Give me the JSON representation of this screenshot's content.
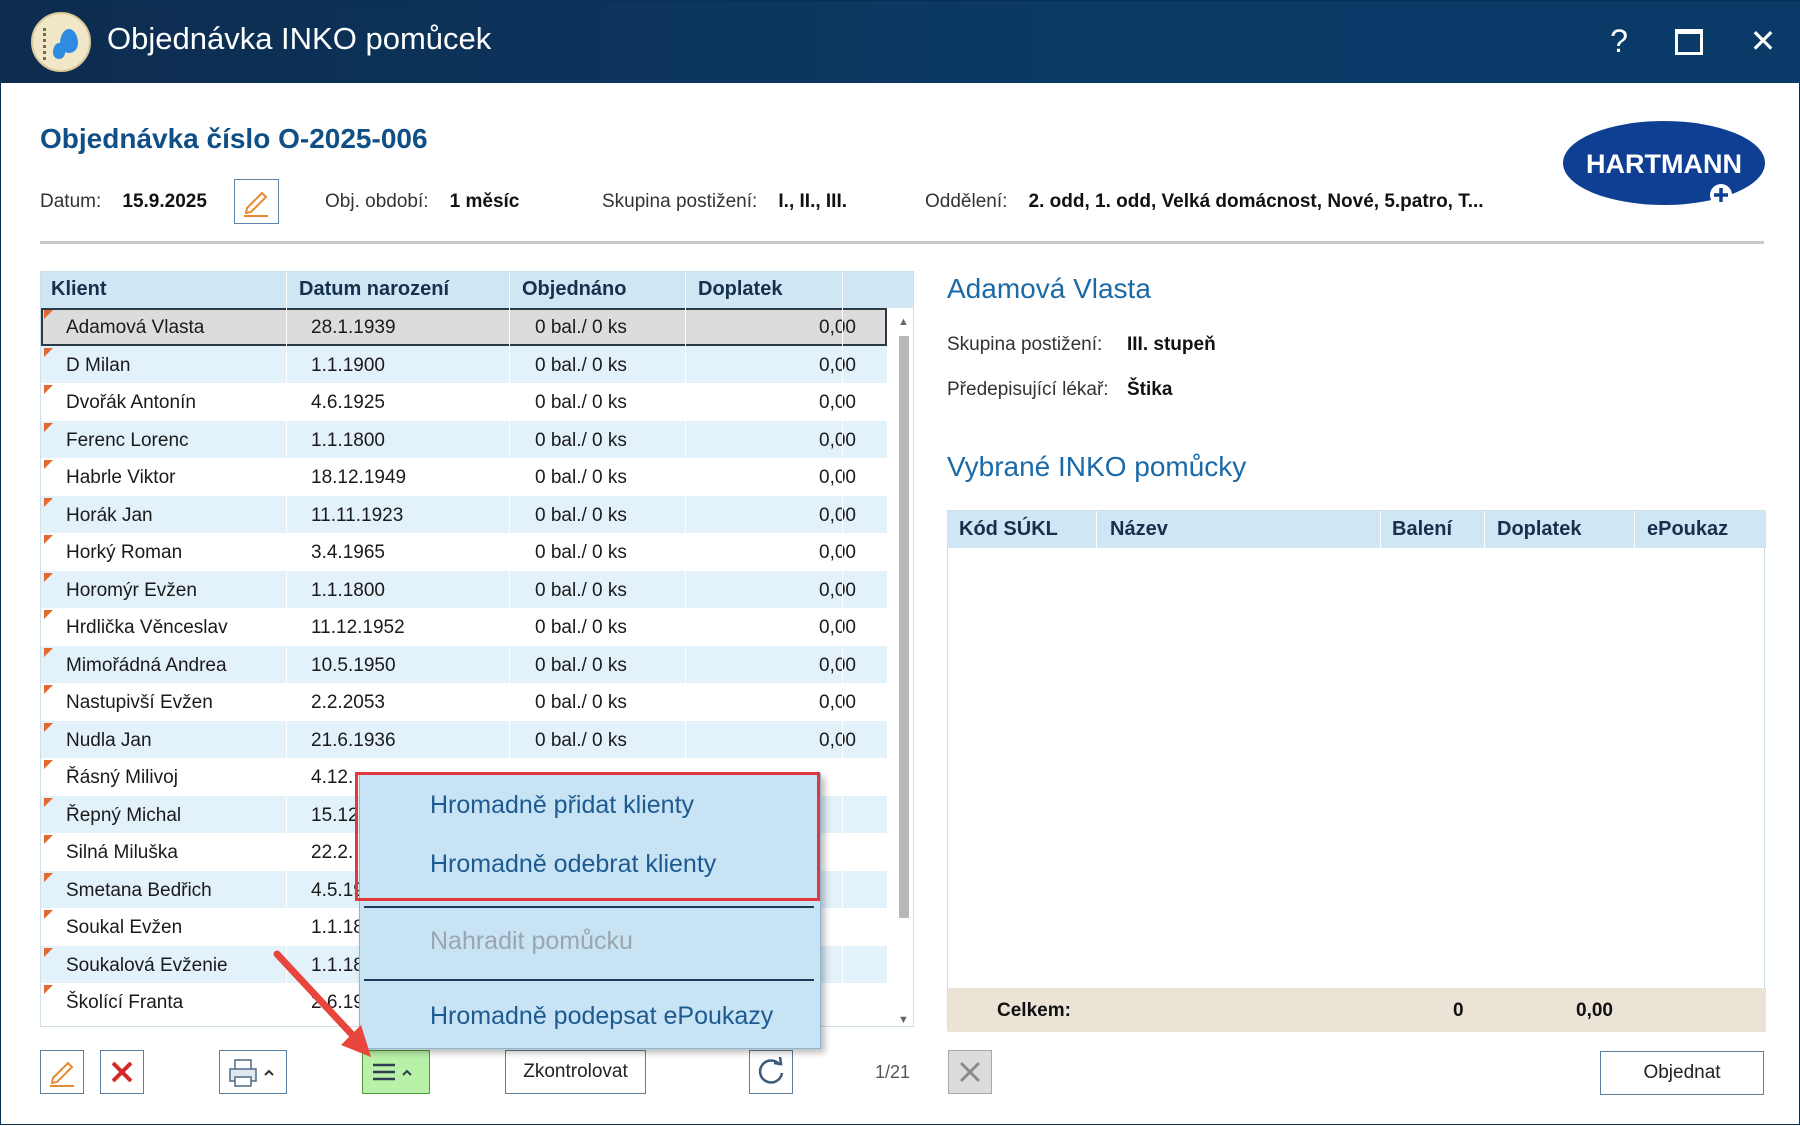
{
  "window": {
    "title": "Objednávka INKO pomůcek",
    "help_label": "?",
    "close_label": "✕"
  },
  "header": {
    "order_title": "Objednávka číslo O-2025-006",
    "brand": "HARTMANN",
    "date_label": "Datum:",
    "date_value": "15.9.2025",
    "period_label": "Obj. období:",
    "period_value": "1 měsíc",
    "group_label": "Skupina postižení:",
    "group_value": "I., II., III.",
    "dept_label": "Oddělení:",
    "dept_value": "2. odd, 1. odd, Velká domácnost, Nové, 5.patro, T..."
  },
  "clients": {
    "columns": [
      "Klient",
      "Datum narození",
      "Objednáno",
      "Doplatek"
    ],
    "rows": [
      [
        "Adamová Vlasta",
        "28.1.1939",
        "0 bal./ 0 ks",
        "0,00"
      ],
      [
        "D Milan",
        "1.1.1900",
        "0 bal./ 0 ks",
        "0,00"
      ],
      [
        "Dvořák Antonín",
        "4.6.1925",
        "0 bal./ 0 ks",
        "0,00"
      ],
      [
        "Ferenc Lorenc",
        "1.1.1800",
        "0 bal./ 0 ks",
        "0,00"
      ],
      [
        "Habrle Viktor",
        "18.12.1949",
        "0 bal./ 0 ks",
        "0,00"
      ],
      [
        "Horák Jan",
        "11.11.1923",
        "0 bal./ 0 ks",
        "0,00"
      ],
      [
        "Horký Roman",
        "3.4.1965",
        "0 bal./ 0 ks",
        "0,00"
      ],
      [
        "Horomýr Evžen",
        "1.1.1800",
        "0 bal./ 0 ks",
        "0,00"
      ],
      [
        "Hrdlička Věnceslav",
        "11.12.1952",
        "0 bal./ 0 ks",
        "0,00"
      ],
      [
        "Mimořádná Andrea",
        "10.5.1950",
        "0 bal./ 0 ks",
        "0,00"
      ],
      [
        "Nastupivší Evžen",
        "2.2.2053",
        "0 bal./ 0 ks",
        "0,00"
      ],
      [
        "Nudla Jan",
        "21.6.1936",
        "0 bal./ 0 ks",
        "0,00"
      ],
      [
        "Řásný Milivoj",
        "4.12.",
        "",
        ""
      ],
      [
        "Řepný Michal",
        "15.12.",
        "",
        ""
      ],
      [
        "Silná Miluška",
        "22.2.",
        "",
        ""
      ],
      [
        "Smetana Bedřich",
        "4.5.19",
        "",
        ""
      ],
      [
        "Soukal Evžen",
        "1.1.18",
        "",
        ""
      ],
      [
        "Soukalová Evženie",
        "1.1.18",
        "",
        ""
      ],
      [
        "Školící Franta",
        "2.6.19",
        "",
        ""
      ]
    ],
    "pager": "1/21"
  },
  "toolbar": {
    "check_label": "Zkontrolovat",
    "order_label": "Objednat"
  },
  "detail": {
    "client_name": "Adamová Vlasta",
    "group_label": "Skupina postižení:",
    "group_value": "III. stupeň",
    "doctor_label": "Předepisující lékař:",
    "doctor_value": "Štika",
    "section_title": "Vybrané INKO pomůcky",
    "columns": [
      "Kód SÚKL",
      "Název",
      "Balení",
      "Doplatek",
      "ePoukaz"
    ],
    "total_label": "Celkem:",
    "total_packages": "0",
    "total_surcharge": "0,00"
  },
  "context_menu": {
    "items": [
      "Hromadně přidat klienty",
      "Hromadně odebrat klienty",
      "Nahradit pomůcku",
      "Hromadně podepsat ePoukazy"
    ]
  },
  "colors": {
    "titlebar": "#0d2c4e",
    "accent": "#1b6aa8",
    "header_bg": "#cfe6f5",
    "highlight": "#e0383e",
    "menu_button": "#b9f1a8"
  }
}
